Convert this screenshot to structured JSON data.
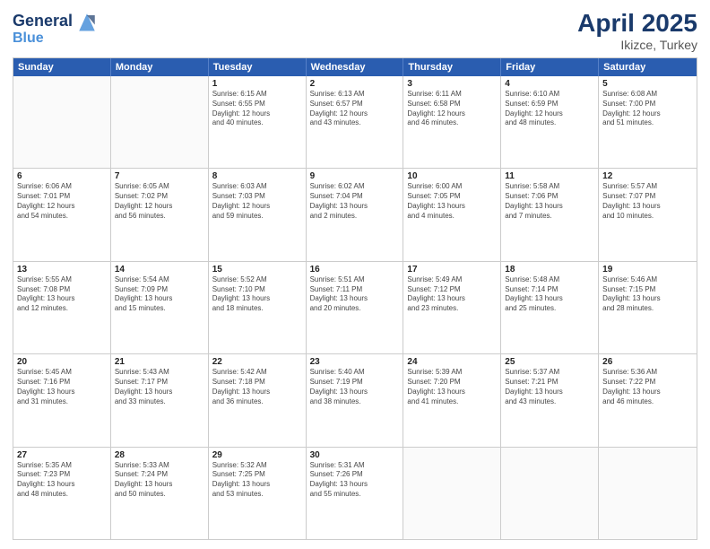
{
  "header": {
    "logo_line1": "General",
    "logo_line2": "Blue",
    "title": "April 2025",
    "subtitle": "Ikizce, Turkey"
  },
  "days": [
    "Sunday",
    "Monday",
    "Tuesday",
    "Wednesday",
    "Thursday",
    "Friday",
    "Saturday"
  ],
  "weeks": [
    [
      {
        "day": "",
        "lines": []
      },
      {
        "day": "",
        "lines": []
      },
      {
        "day": "1",
        "lines": [
          "Sunrise: 6:15 AM",
          "Sunset: 6:55 PM",
          "Daylight: 12 hours",
          "and 40 minutes."
        ]
      },
      {
        "day": "2",
        "lines": [
          "Sunrise: 6:13 AM",
          "Sunset: 6:57 PM",
          "Daylight: 12 hours",
          "and 43 minutes."
        ]
      },
      {
        "day": "3",
        "lines": [
          "Sunrise: 6:11 AM",
          "Sunset: 6:58 PM",
          "Daylight: 12 hours",
          "and 46 minutes."
        ]
      },
      {
        "day": "4",
        "lines": [
          "Sunrise: 6:10 AM",
          "Sunset: 6:59 PM",
          "Daylight: 12 hours",
          "and 48 minutes."
        ]
      },
      {
        "day": "5",
        "lines": [
          "Sunrise: 6:08 AM",
          "Sunset: 7:00 PM",
          "Daylight: 12 hours",
          "and 51 minutes."
        ]
      }
    ],
    [
      {
        "day": "6",
        "lines": [
          "Sunrise: 6:06 AM",
          "Sunset: 7:01 PM",
          "Daylight: 12 hours",
          "and 54 minutes."
        ]
      },
      {
        "day": "7",
        "lines": [
          "Sunrise: 6:05 AM",
          "Sunset: 7:02 PM",
          "Daylight: 12 hours",
          "and 56 minutes."
        ]
      },
      {
        "day": "8",
        "lines": [
          "Sunrise: 6:03 AM",
          "Sunset: 7:03 PM",
          "Daylight: 12 hours",
          "and 59 minutes."
        ]
      },
      {
        "day": "9",
        "lines": [
          "Sunrise: 6:02 AM",
          "Sunset: 7:04 PM",
          "Daylight: 13 hours",
          "and 2 minutes."
        ]
      },
      {
        "day": "10",
        "lines": [
          "Sunrise: 6:00 AM",
          "Sunset: 7:05 PM",
          "Daylight: 13 hours",
          "and 4 minutes."
        ]
      },
      {
        "day": "11",
        "lines": [
          "Sunrise: 5:58 AM",
          "Sunset: 7:06 PM",
          "Daylight: 13 hours",
          "and 7 minutes."
        ]
      },
      {
        "day": "12",
        "lines": [
          "Sunrise: 5:57 AM",
          "Sunset: 7:07 PM",
          "Daylight: 13 hours",
          "and 10 minutes."
        ]
      }
    ],
    [
      {
        "day": "13",
        "lines": [
          "Sunrise: 5:55 AM",
          "Sunset: 7:08 PM",
          "Daylight: 13 hours",
          "and 12 minutes."
        ]
      },
      {
        "day": "14",
        "lines": [
          "Sunrise: 5:54 AM",
          "Sunset: 7:09 PM",
          "Daylight: 13 hours",
          "and 15 minutes."
        ]
      },
      {
        "day": "15",
        "lines": [
          "Sunrise: 5:52 AM",
          "Sunset: 7:10 PM",
          "Daylight: 13 hours",
          "and 18 minutes."
        ]
      },
      {
        "day": "16",
        "lines": [
          "Sunrise: 5:51 AM",
          "Sunset: 7:11 PM",
          "Daylight: 13 hours",
          "and 20 minutes."
        ]
      },
      {
        "day": "17",
        "lines": [
          "Sunrise: 5:49 AM",
          "Sunset: 7:12 PM",
          "Daylight: 13 hours",
          "and 23 minutes."
        ]
      },
      {
        "day": "18",
        "lines": [
          "Sunrise: 5:48 AM",
          "Sunset: 7:14 PM",
          "Daylight: 13 hours",
          "and 25 minutes."
        ]
      },
      {
        "day": "19",
        "lines": [
          "Sunrise: 5:46 AM",
          "Sunset: 7:15 PM",
          "Daylight: 13 hours",
          "and 28 minutes."
        ]
      }
    ],
    [
      {
        "day": "20",
        "lines": [
          "Sunrise: 5:45 AM",
          "Sunset: 7:16 PM",
          "Daylight: 13 hours",
          "and 31 minutes."
        ]
      },
      {
        "day": "21",
        "lines": [
          "Sunrise: 5:43 AM",
          "Sunset: 7:17 PM",
          "Daylight: 13 hours",
          "and 33 minutes."
        ]
      },
      {
        "day": "22",
        "lines": [
          "Sunrise: 5:42 AM",
          "Sunset: 7:18 PM",
          "Daylight: 13 hours",
          "and 36 minutes."
        ]
      },
      {
        "day": "23",
        "lines": [
          "Sunrise: 5:40 AM",
          "Sunset: 7:19 PM",
          "Daylight: 13 hours",
          "and 38 minutes."
        ]
      },
      {
        "day": "24",
        "lines": [
          "Sunrise: 5:39 AM",
          "Sunset: 7:20 PM",
          "Daylight: 13 hours",
          "and 41 minutes."
        ]
      },
      {
        "day": "25",
        "lines": [
          "Sunrise: 5:37 AM",
          "Sunset: 7:21 PM",
          "Daylight: 13 hours",
          "and 43 minutes."
        ]
      },
      {
        "day": "26",
        "lines": [
          "Sunrise: 5:36 AM",
          "Sunset: 7:22 PM",
          "Daylight: 13 hours",
          "and 46 minutes."
        ]
      }
    ],
    [
      {
        "day": "27",
        "lines": [
          "Sunrise: 5:35 AM",
          "Sunset: 7:23 PM",
          "Daylight: 13 hours",
          "and 48 minutes."
        ]
      },
      {
        "day": "28",
        "lines": [
          "Sunrise: 5:33 AM",
          "Sunset: 7:24 PM",
          "Daylight: 13 hours",
          "and 50 minutes."
        ]
      },
      {
        "day": "29",
        "lines": [
          "Sunrise: 5:32 AM",
          "Sunset: 7:25 PM",
          "Daylight: 13 hours",
          "and 53 minutes."
        ]
      },
      {
        "day": "30",
        "lines": [
          "Sunrise: 5:31 AM",
          "Sunset: 7:26 PM",
          "Daylight: 13 hours",
          "and 55 minutes."
        ]
      },
      {
        "day": "",
        "lines": []
      },
      {
        "day": "",
        "lines": []
      },
      {
        "day": "",
        "lines": []
      }
    ]
  ]
}
